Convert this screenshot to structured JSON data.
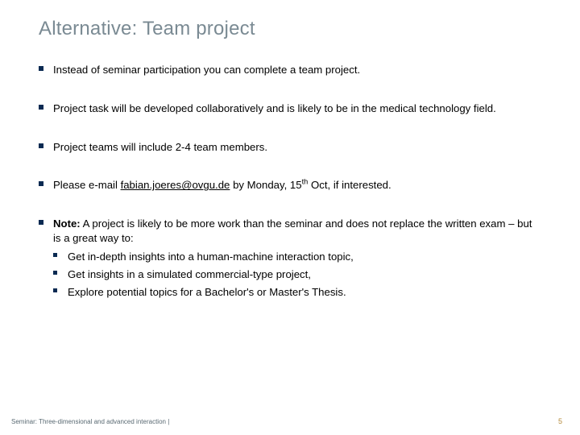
{
  "title": "Alternative: Team project",
  "bullets": [
    {
      "text": "Instead of seminar participation you can complete a team project."
    },
    {
      "text": "Project task will be developed collaboratively and is likely to be in the medical technology field."
    },
    {
      "text": "Project teams will include 2-4 team members."
    },
    {
      "prefix": "Please e-mail ",
      "email": "fabian.joeres@ovgu.de",
      "mid": " by Monday, 15",
      "sup": "th",
      "suffix": " Oct, if interested."
    },
    {
      "lead_bold": "Note:",
      "lead_rest": " A project is likely to be more work than the seminar and does not replace the written exam – but is a great way to:",
      "sub": [
        "Get in-depth insights into a human-machine interaction topic,",
        "Get insights in a simulated commercial-type project,",
        "Explore potential topics for a Bachelor's or Master's Thesis."
      ]
    }
  ],
  "footer": "Seminar: Three-dimensional and advanced interaction |",
  "page": "5"
}
